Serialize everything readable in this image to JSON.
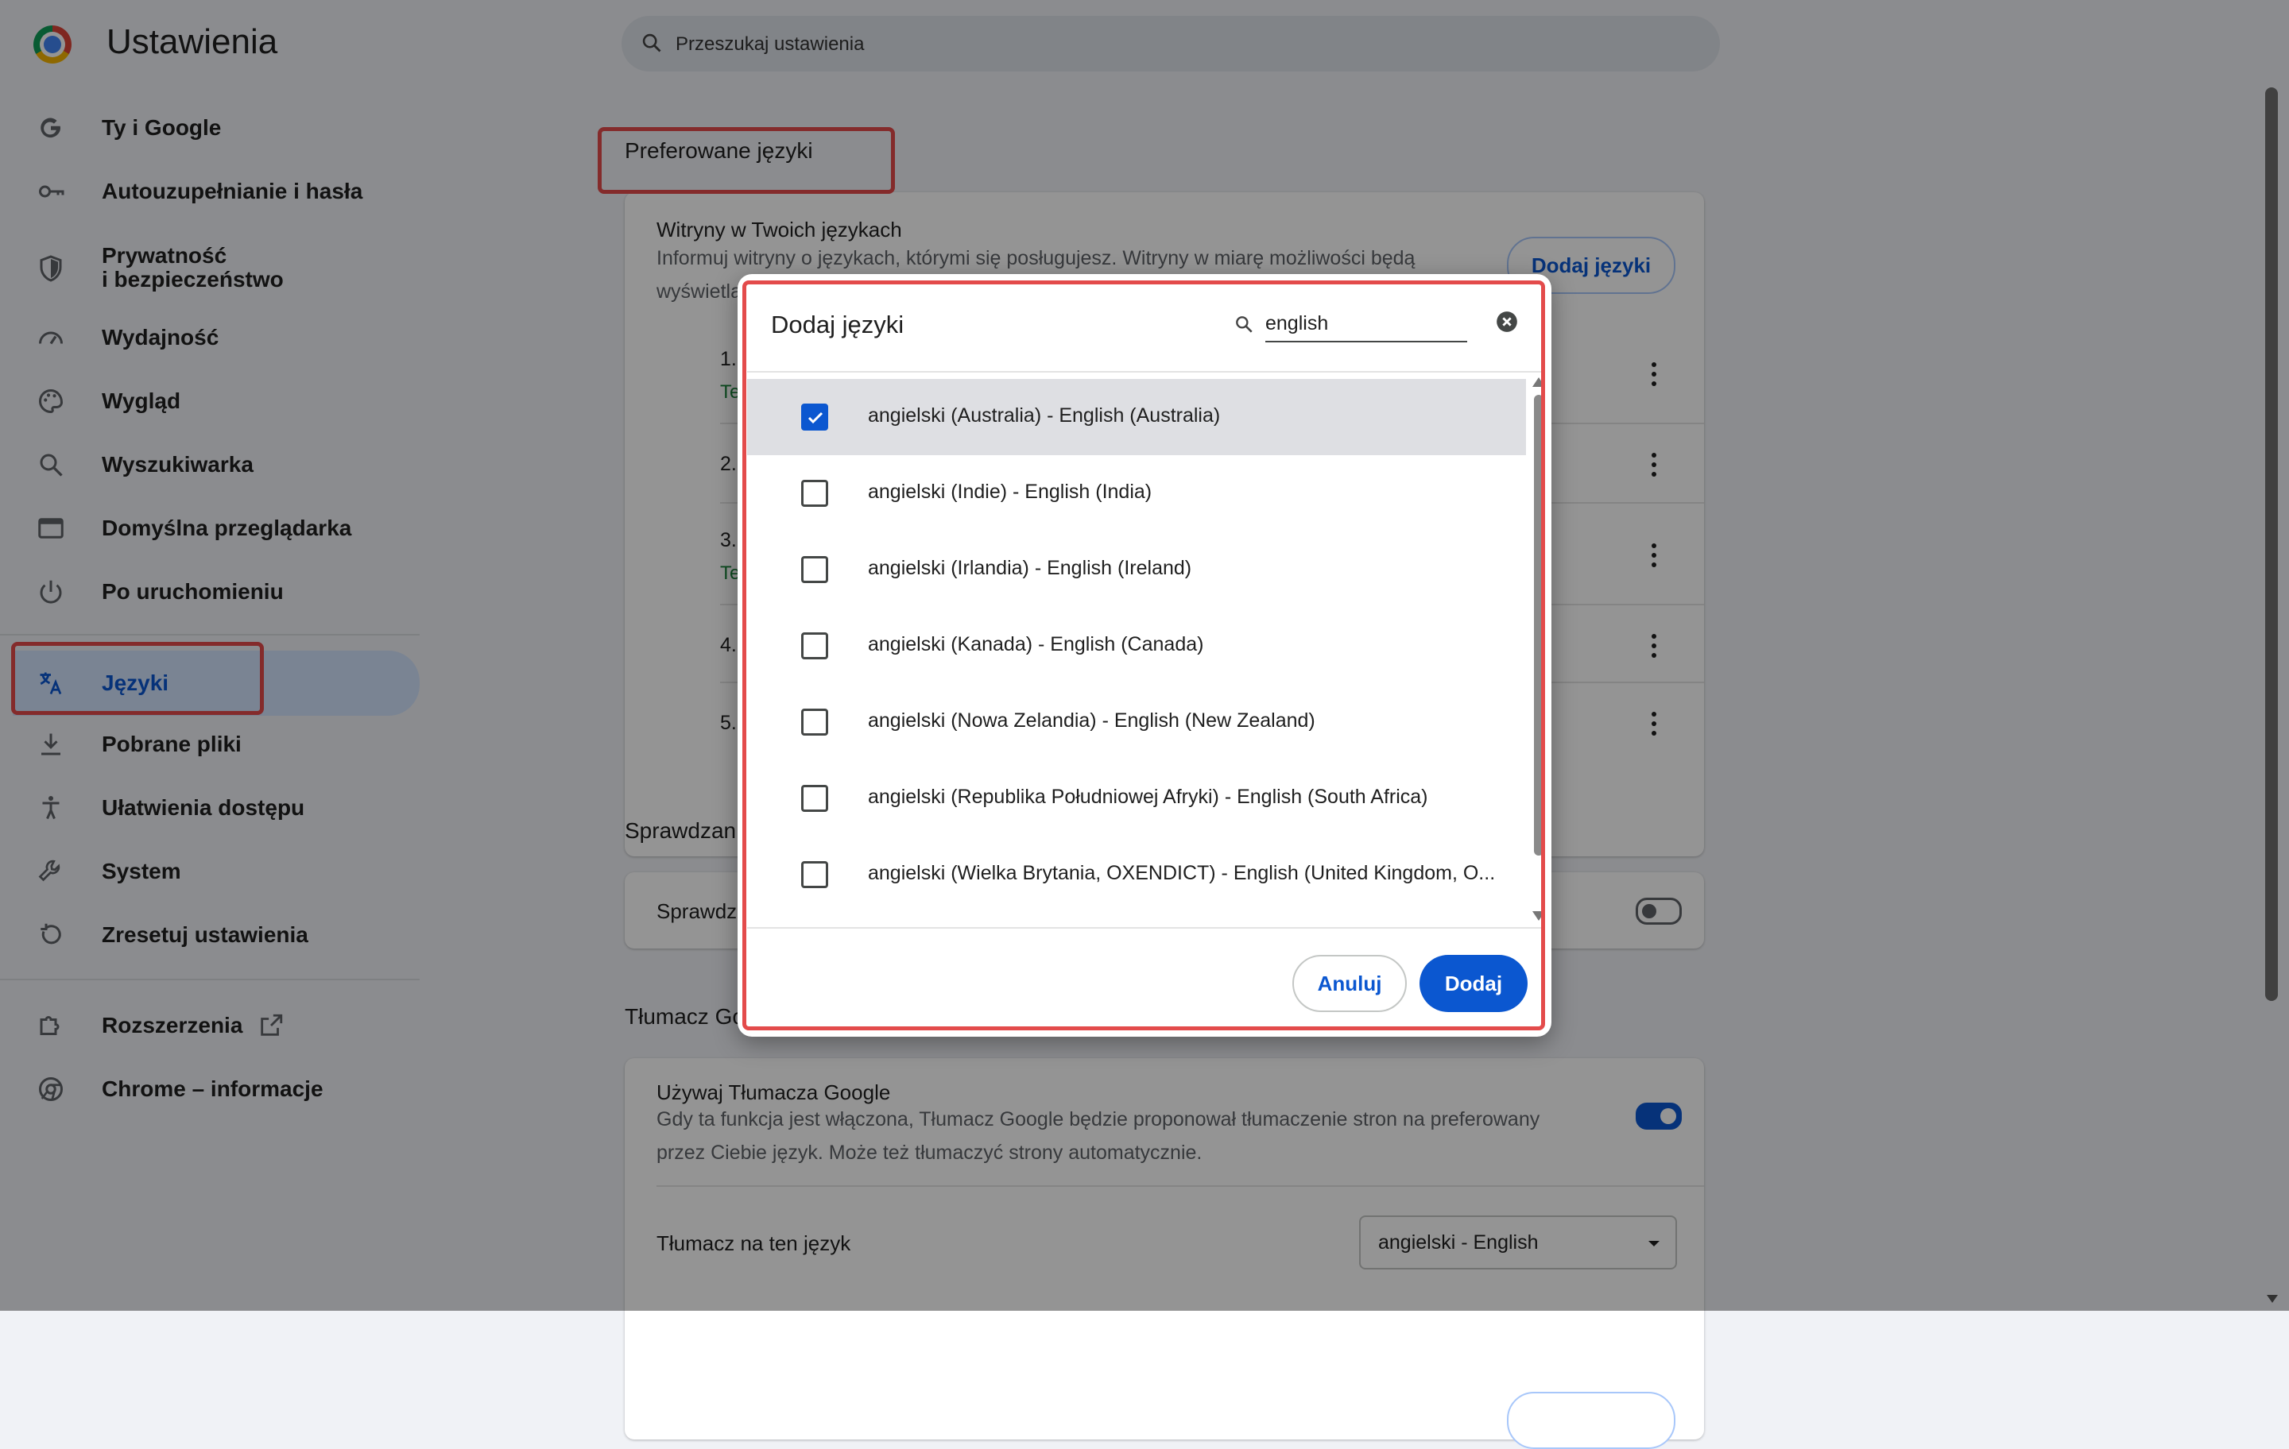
{
  "app": {
    "title": "Ustawienia"
  },
  "search": {
    "placeholder": "Przeszukaj ustawienia"
  },
  "sidebar": {
    "items": [
      {
        "label": "Ty i Google",
        "icon": "google-g-icon"
      },
      {
        "label": "Autouzupełnianie i hasła",
        "icon": "key-icon"
      },
      {
        "label_line1": "Prywatność",
        "label_line2": "i bezpieczeństwo",
        "icon": "shield-icon"
      },
      {
        "label": "Wydajność",
        "icon": "speedometer-icon"
      },
      {
        "label": "Wygląd",
        "icon": "palette-icon"
      },
      {
        "label": "Wyszukiwarka",
        "icon": "search-icon"
      },
      {
        "label": "Domyślna przeglądarka",
        "icon": "browser-window-icon"
      },
      {
        "label": "Po uruchomieniu",
        "icon": "power-icon"
      },
      {
        "label": "Języki",
        "icon": "translate-icon",
        "active": true
      },
      {
        "label": "Pobrane pliki",
        "icon": "download-icon"
      },
      {
        "label": "Ułatwienia dostępu",
        "icon": "accessibility-icon"
      },
      {
        "label": "System",
        "icon": "wrench-icon"
      },
      {
        "label": "Zresetuj ustawienia",
        "icon": "reset-icon"
      },
      {
        "label": "Rozszerzenia",
        "icon": "puzzle-icon"
      },
      {
        "label": "Chrome – informacje",
        "icon": "chrome-icon"
      }
    ]
  },
  "main": {
    "preferred_title": "Preferowane języki",
    "sites_card": {
      "title": "Witryny w Twoich językach",
      "desc_line1": "Informuj witryny o językach, którymi się posługujesz. Witryny w miarę możliwości będą",
      "desc_line2": "wyświetla",
      "add_button": "Dodaj języki",
      "rows": [
        {
          "num": "1.",
          "sub": "Te"
        },
        {
          "num": "2.",
          "sub": ""
        },
        {
          "num": "3.",
          "sub": "Te"
        },
        {
          "num": "4.",
          "sub": ""
        },
        {
          "num": "5.",
          "sub": ""
        }
      ]
    },
    "spellcheck_title": "Sprawdzan",
    "spellcheck_card": {
      "label": "Sprawdza",
      "toggle_on": false
    },
    "translate_title": "Tłumacz Go",
    "translate_card": {
      "title": "Używaj Tłumacza Google",
      "desc_line1": "Gdy ta funkcja jest włączona, Tłumacz Google będzie proponował tłumaczenie stron na preferowany",
      "desc_line2": "przez Ciebie język. Może też tłumaczyć strony automatycznie.",
      "toggle_on": true,
      "target_label": "Tłumacz na ten język",
      "target_value": "angielski - English"
    }
  },
  "dialog": {
    "title": "Dodaj języki",
    "search_value": "english",
    "items": [
      {
        "label": "angielski (Australia) - English (Australia)",
        "checked": true
      },
      {
        "label": "angielski (Indie) - English (India)",
        "checked": false
      },
      {
        "label": "angielski (Irlandia) - English (Ireland)",
        "checked": false
      },
      {
        "label": "angielski (Kanada) - English (Canada)",
        "checked": false
      },
      {
        "label": "angielski (Nowa Zelandia) - English (New Zealand)",
        "checked": false
      },
      {
        "label": "angielski (Republika Południowej Afryki) - English (South Africa)",
        "checked": false
      },
      {
        "label": "angielski (Wielka Brytania, OXENDICT) - English (United Kingdom, O...",
        "checked": false
      }
    ],
    "cancel_label": "Anuluj",
    "add_label": "Dodaj"
  },
  "colors": {
    "accent": "#0b57d0",
    "highlight": "#e34b4b",
    "active_nav_bg": "#d3e3fd"
  }
}
